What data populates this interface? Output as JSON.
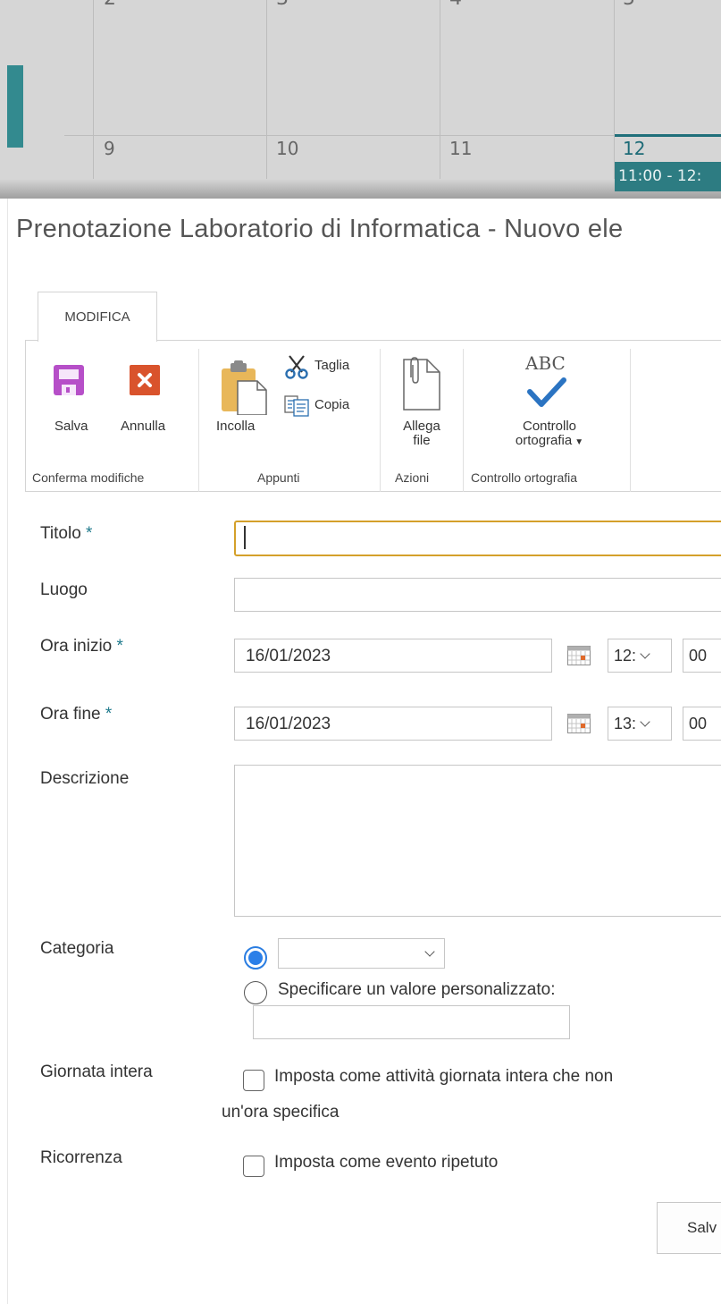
{
  "calendar": {
    "top_row": [
      "2",
      "3",
      "4",
      "5"
    ],
    "bottom_row": [
      "9",
      "10",
      "11",
      "12"
    ],
    "event_text": "11:00 - 12:"
  },
  "page": {
    "title": "Prenotazione Laboratorio di Informatica - Nuovo ele"
  },
  "ribbon": {
    "tab_label": "MODIFICA",
    "save_label": "Salva",
    "cancel_label": "Annulla",
    "paste_label": "Incolla",
    "cut_label": "Taglia",
    "copy_label": "Copia",
    "attach_label_line1": "Allega",
    "attach_label_line2": "file",
    "spell_icon_text": "ABC",
    "spell_label_line1": "Controllo",
    "spell_label_line2": "ortografia",
    "groups": {
      "commit": "Conferma modifiche",
      "clipboard": "Appunti",
      "actions": "Azioni",
      "spelling": "Controllo ortografia"
    }
  },
  "form": {
    "required_mark": "*",
    "title_label": "Titolo",
    "title_value": "",
    "location_label": "Luogo",
    "location_value": "",
    "start_label": "Ora inizio",
    "start_date": "16/01/2023",
    "start_hour": "12:",
    "start_minute": "00",
    "end_label": "Ora fine",
    "end_date": "16/01/2023",
    "end_hour": "13:",
    "end_minute": "00",
    "description_label": "Descrizione",
    "category_label": "Categoria",
    "category_selected": "",
    "category_custom_label": "Specificare un valore personalizzato:",
    "allday_label": "Giornata intera",
    "allday_text_line1": "Imposta come attività giornata intera che non",
    "allday_text_line2": "un'ora specifica",
    "recurrence_label": "Ricorrenza",
    "recurrence_text": "Imposta come evento ripetuto",
    "save_button": "Salv"
  },
  "colors": {
    "accent_teal": "#2d7c82",
    "required_star": "#1f7a8c",
    "focus_border": "#d4a02a",
    "save_icon": "#b64fc8",
    "cancel_icon": "#d9532c",
    "radio_selected": "#2b7fe8"
  }
}
